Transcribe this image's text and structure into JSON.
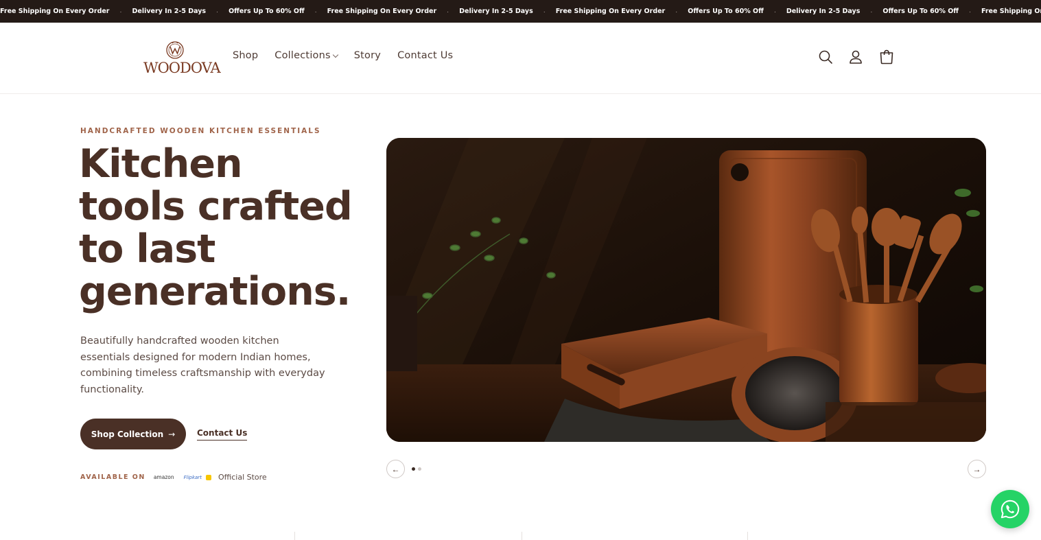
{
  "announcement": {
    "items": [
      "Free Shipping On Every Order",
      "Delivery In 2-5 Days",
      "Offers Up To 60% Off",
      "Free Shipping On Every Order",
      "Delivery In 2-5 Days",
      "Free Shipping On Every Order",
      "Offers Up To 60% Off",
      "Delivery In 2-5 Days",
      "Offers Up To 60% Off",
      "Free Shipping On Every Ord"
    ],
    "separator": "·"
  },
  "header": {
    "logo_text": "WOODOVA",
    "nav": [
      {
        "label": "Shop"
      },
      {
        "label": "Collections"
      },
      {
        "label": "Story"
      },
      {
        "label": "Contact Us"
      }
    ],
    "icons": [
      "search-icon",
      "account-icon",
      "cart-icon"
    ]
  },
  "hero": {
    "eyebrow": "HANDCRAFTED WOODEN KITCHEN ESSENTIALS",
    "headline_lines": [
      "Kitchen",
      "tools crafted",
      "to last",
      "generations."
    ],
    "description": "Beautifully handcrafted wooden kitchen essentials designed for modern Indian homes, combining timeless craftsmanship with everyday functionality.",
    "primary_button": "Shop Collection",
    "primary_button_arrow": "→",
    "secondary_link": "Contact Us",
    "available_label": "AVAILABLE ON",
    "stores": {
      "amazon": "amazon",
      "flipkart": "Flipkart",
      "official": "Official Store"
    }
  },
  "carousel": {
    "prev_icon": "←",
    "next_icon": "→",
    "slides_count": 2,
    "active_index": 0
  },
  "colors": {
    "brand_dark": "#4a3026",
    "accent": "#a0644a",
    "announce_bg": "#241a16",
    "whatsapp": "#25d366"
  }
}
